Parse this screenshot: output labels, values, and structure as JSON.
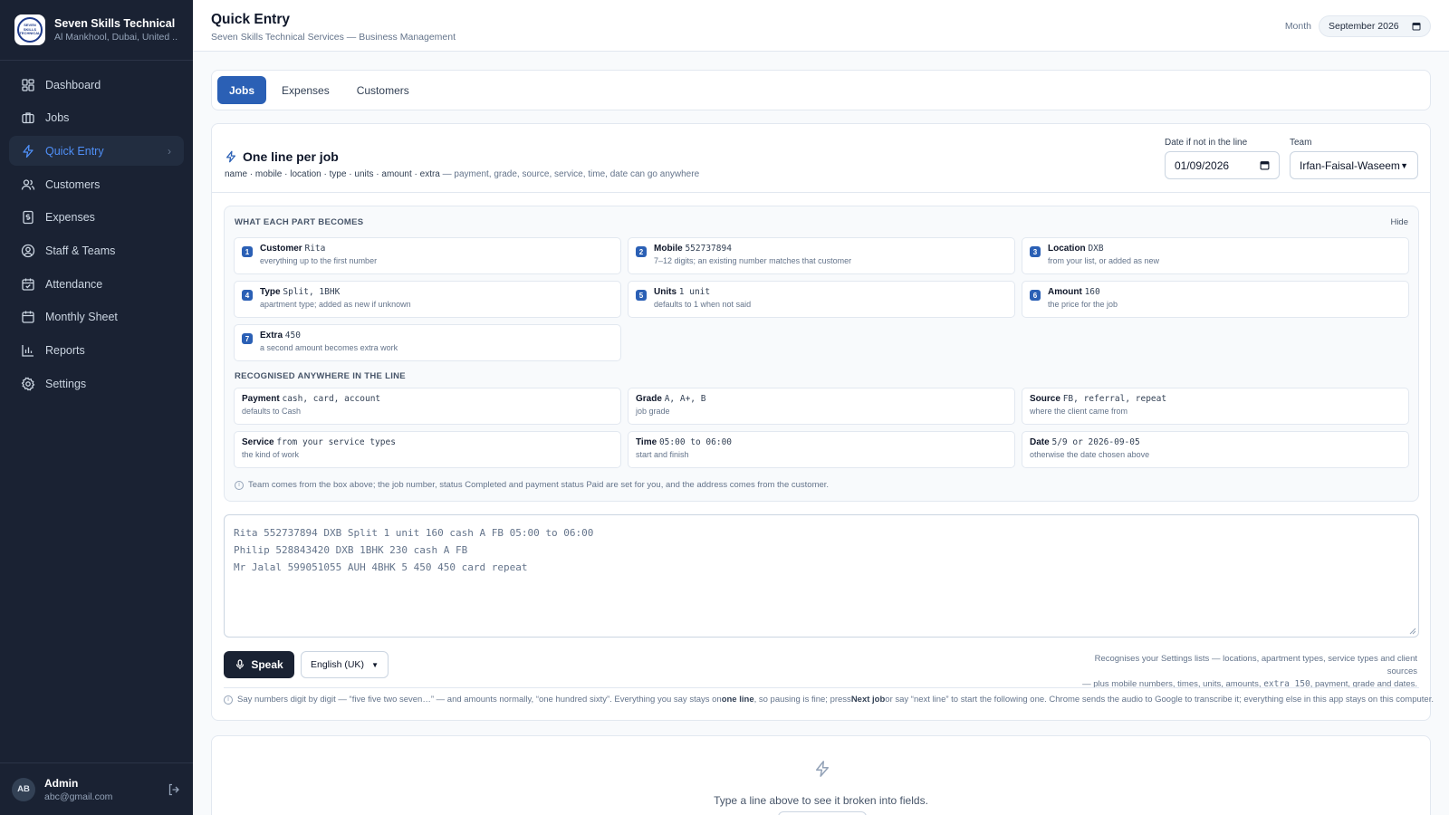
{
  "brand": {
    "logo_text": "SEVEN SKILLS TECHNICAL",
    "title": "Seven Skills Technical ...",
    "subtitle": "Al Mankhool, Dubai, United ..."
  },
  "nav": [
    {
      "label": "Dashboard",
      "icon": "dashboard-icon"
    },
    {
      "label": "Jobs",
      "icon": "briefcase-icon"
    },
    {
      "label": "Quick Entry",
      "icon": "lightning-icon",
      "active": true
    },
    {
      "label": "Customers",
      "icon": "users-icon"
    },
    {
      "label": "Expenses",
      "icon": "receipt-icon"
    },
    {
      "label": "Staff & Teams",
      "icon": "user-circle-icon"
    },
    {
      "label": "Attendance",
      "icon": "calendar-check-icon"
    },
    {
      "label": "Monthly Sheet",
      "icon": "calendar-icon"
    },
    {
      "label": "Reports",
      "icon": "bar-chart-icon"
    },
    {
      "label": "Settings",
      "icon": "gear-icon"
    }
  ],
  "user": {
    "initials": "AB",
    "name": "Admin",
    "email": "abc@gmail.com"
  },
  "header": {
    "title": "Quick Entry",
    "subtitle": "Seven Skills Technical Services — Business Management",
    "month_label": "Month",
    "month_value": "September 2026"
  },
  "tabs": [
    {
      "label": "Jobs",
      "active": true
    },
    {
      "label": "Expenses"
    },
    {
      "label": "Customers"
    }
  ],
  "entry": {
    "title": "One line per job",
    "hint_fields": "name · mobile · location · type · units · amount · extra",
    "hint_rest": " — payment, grade, source, service, time, date can go anywhere",
    "date_label": "Date if not in the line",
    "date_value": "01/09/2026",
    "team_label": "Team",
    "team_value": "Irfan-Faisal-Waseem"
  },
  "parts": {
    "title": "WHAT EACH PART BECOMES",
    "hide_label": "Hide",
    "items": [
      {
        "n": "1",
        "name": "Customer",
        "example": "Rita",
        "desc": "everything up to the first number"
      },
      {
        "n": "2",
        "name": "Mobile",
        "example": "552737894",
        "desc": "7–12 digits; an existing number matches that customer"
      },
      {
        "n": "3",
        "name": "Location",
        "example": "DXB",
        "desc": "from your list, or added as new"
      },
      {
        "n": "4",
        "name": "Type",
        "example": "Split, 1BHK",
        "desc": "apartment type; added as new if unknown"
      },
      {
        "n": "5",
        "name": "Units",
        "example": "1 unit",
        "desc": "defaults to 1 when not said"
      },
      {
        "n": "6",
        "name": "Amount",
        "example": "160",
        "desc": "the price for the job"
      },
      {
        "n": "7",
        "name": "Extra",
        "example": "450",
        "desc": "a second amount becomes extra work"
      }
    ],
    "recognised_title": "RECOGNISED ANYWHERE IN THE LINE",
    "recognised": [
      {
        "name": "Payment",
        "example": "cash, card, account",
        "desc": "defaults to Cash"
      },
      {
        "name": "Grade",
        "example": "A, A+, B",
        "desc": "job grade"
      },
      {
        "name": "Source",
        "example": "FB, referral, repeat",
        "desc": "where the client came from"
      },
      {
        "name": "Service",
        "example": "from your service types",
        "desc": "the kind of work"
      },
      {
        "name": "Time",
        "example": "05:00 to 06:00",
        "desc": "start and finish"
      },
      {
        "name": "Date",
        "example": "5/9 or 2026-09-05",
        "desc": "otherwise the date chosen above"
      }
    ],
    "team_note": "Team comes from the box above; the job number, status Completed and payment status Paid are set for you, and the address comes from the customer."
  },
  "textarea_lines": [
    "Rita 552737894 DXB Split 1 unit 160 cash A FB 05:00 to 06:00",
    "Philip 528843420 DXB 1BHK 230 cash A FB",
    "Mr Jalal 599051055 AUH 4BHK 5 450 450 card repeat"
  ],
  "speak": {
    "label": "Speak",
    "language": "English (UK)"
  },
  "recognises_note": {
    "line1": "Recognises your Settings lists — locations, apartment types, service types and client sources",
    "line2_a": "— plus mobile numbers, times, units, amounts, ",
    "line2_code": "extra 150",
    "line2_b": ", payment, grade and dates."
  },
  "say_note": {
    "a": "Say numbers digit by digit — “five five two seven…” — and amounts normally, “one hundred sixty”. Everything you say stays on ",
    "b": "one line",
    "c": ", so pausing is fine; press ",
    "d": "Next job",
    "e": " or say “next line” to start the following one. Chrome sends the audio to Google to transcribe it; everything else in this app stays on this computer."
  },
  "preview": {
    "text": "Type a line above to see it broken into fields."
  }
}
